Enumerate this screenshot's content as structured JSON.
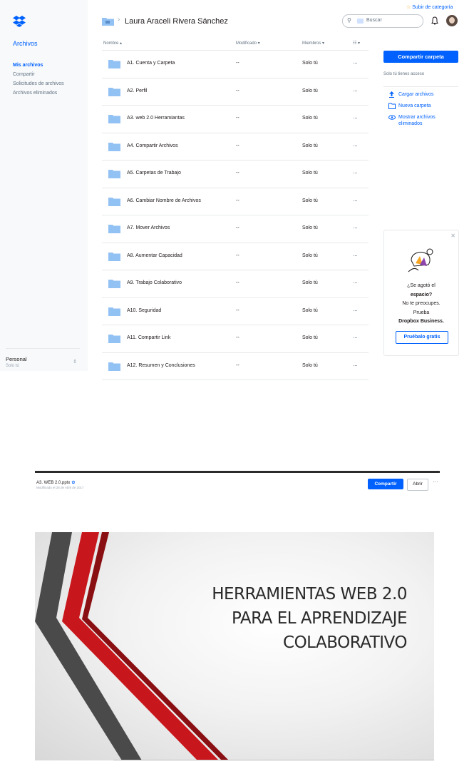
{
  "sidebar": {
    "title": "Archivos",
    "nav": [
      "Mis archivos",
      "Compartir",
      "Solicitudes de archivos",
      "Archivos eliminados"
    ],
    "account": {
      "name": "Personal",
      "sub": "Solo tú"
    }
  },
  "header": {
    "breadcrumb_title": "Laura Araceli Rivera Sánchez",
    "upgrade_link": "Subir de categoría",
    "search_placeholder": "Buscar"
  },
  "table": {
    "columns": {
      "name": "Nombre ▴",
      "modified": "Modificado ▾",
      "members": "Miembros ▾"
    },
    "rows": [
      {
        "name": "A1. Cuenta y Carpeta",
        "modified": "--",
        "members": "Solo tú"
      },
      {
        "name": "A2. Perfil",
        "modified": "--",
        "members": "Solo tú"
      },
      {
        "name": "A3. web 2.0 Herramiantas",
        "modified": "--",
        "members": "Solo tú"
      },
      {
        "name": "A4. Compartir Archivos",
        "modified": "--",
        "members": "Solo tú"
      },
      {
        "name": "A5. Carpetas de Trabajo",
        "modified": "--",
        "members": "Solo tú"
      },
      {
        "name": "A6. Cambiar Nombre de Archivos",
        "modified": "--",
        "members": "Solo tú"
      },
      {
        "name": "A7. Mover Archivos",
        "modified": "--",
        "members": "Solo tú"
      },
      {
        "name": "A8. Aumentar Capacidad",
        "modified": "--",
        "members": "Solo tú"
      },
      {
        "name": "A9. Trabajo Colaborativo",
        "modified": "--",
        "members": "Solo tú"
      },
      {
        "name": "A10. Seguridad",
        "modified": "--",
        "members": "Solo tú"
      },
      {
        "name": "A11. Compartir Link",
        "modified": "--",
        "members": "Solo tú"
      },
      {
        "name": "A12. Resumen y Conclusiones",
        "modified": "--",
        "members": "Solo tú"
      }
    ]
  },
  "right_panel": {
    "share_button": "Compartir carpeta",
    "access_note": "Solo tú tienes acceso",
    "actions": [
      "Cargar archivos",
      "Nueva carpeta",
      "Mostrar archivos eliminados"
    ]
  },
  "promo": {
    "line1": "¿Se agotó el",
    "line2": "espacio?",
    "line3": "No te preocupes.",
    "line4": "Prueba",
    "line5": "Dropbox Business.",
    "button": "Pruébalo gratis"
  },
  "preview": {
    "file_name": "A3. WEB 2.0.pptx",
    "modified": "Modificado el 25 de Abril de 2017",
    "share_button": "Compartir",
    "open_button": "Abrir",
    "slide_title": [
      "HERRAMIENTAS WEB 2.0",
      "PARA EL APRENDIZAJE",
      "COLABORATIVO"
    ]
  },
  "colors": {
    "accent": "#0061fe",
    "folder": "#92c1f3",
    "slide_red": "#c8171c",
    "slide_dark": "#4a4a4a"
  }
}
